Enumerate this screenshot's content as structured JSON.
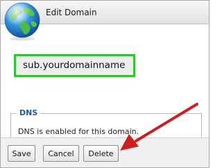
{
  "dialog": {
    "title": "Edit Domain",
    "icon": "globe-icon"
  },
  "domain": {
    "name": "sub.yourdomainname",
    "highlight_color": "#33c233"
  },
  "dns": {
    "legend": "DNS",
    "message": "DNS is enabled for this domain."
  },
  "buttons": {
    "save": "Save",
    "cancel": "Cancel",
    "delete": "Delete"
  },
  "annotation": {
    "type": "arrow",
    "color": "#cc1f1f",
    "points_to": "delete-button"
  }
}
